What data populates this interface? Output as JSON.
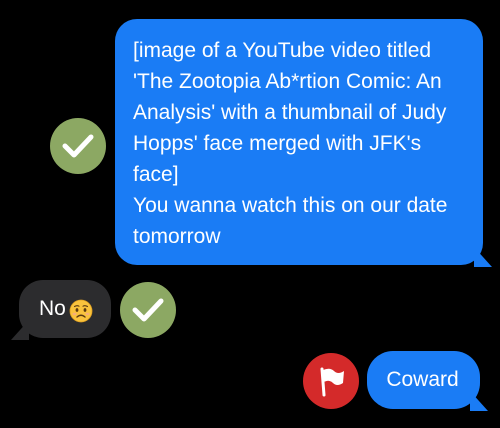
{
  "messages": [
    {
      "direction": "sent",
      "lines": [
        "[image of a YouTube video titled",
        "'The Zootopia Ab*rtion Comic: An",
        "Analysis' with a thumbnail of Judy",
        "Hopps' face merged with JFK's",
        "face]",
        "You wanna watch this on our date",
        "tomorrow"
      ],
      "reaction": "checkmark-icon"
    },
    {
      "direction": "received",
      "text": "No",
      "emoji": "worried-face-emoji",
      "reaction": "checkmark-icon"
    },
    {
      "direction": "sent",
      "text": "Coward",
      "reaction": "flag-icon"
    }
  ],
  "colors": {
    "background": "#000000",
    "sent_bubble": "#1a7cf5",
    "received_bubble": "#2c2c2e",
    "check_reaction": "#8ca863",
    "flag_reaction": "#d42a2a"
  }
}
